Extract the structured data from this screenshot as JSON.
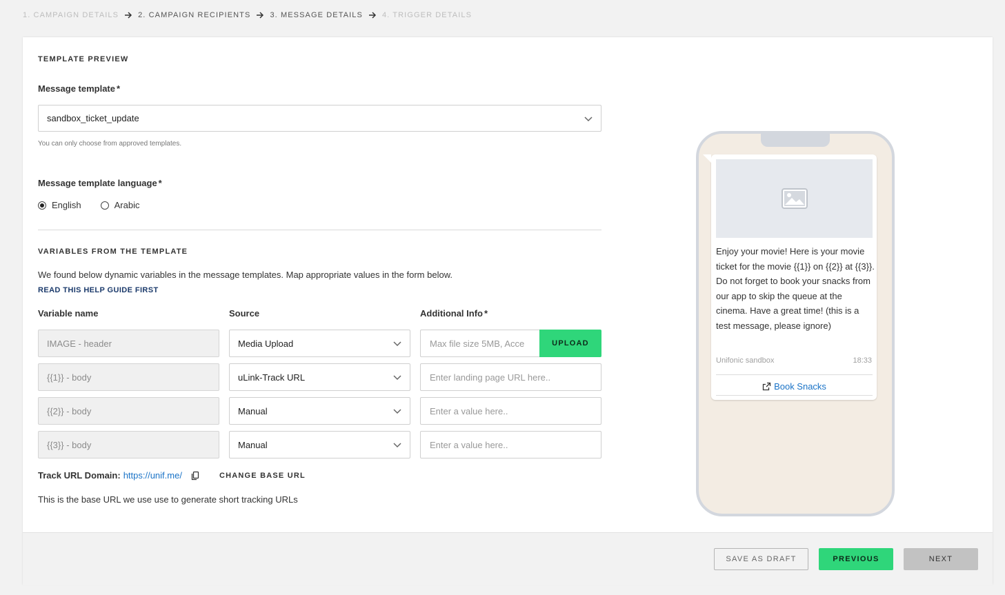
{
  "stepper": {
    "steps": [
      {
        "label": "1. CAMPAIGN DETAILS",
        "state": "inactive"
      },
      {
        "label": "2. CAMPAIGN RECIPIENTS",
        "state": "active"
      },
      {
        "label": "3. MESSAGE DETAILS",
        "state": "active"
      },
      {
        "label": "4. TRIGGER DETAILS",
        "state": "inactive"
      }
    ]
  },
  "template_preview": {
    "title": "TEMPLATE PREVIEW",
    "message_template": {
      "label": "Message template",
      "required_mark": "*",
      "value": "sandbox_ticket_update",
      "helper": "You can only choose from approved templates."
    },
    "language": {
      "label": "Message template language",
      "required_mark": "*",
      "options": [
        {
          "label": "English",
          "checked": true
        },
        {
          "label": "Arabic",
          "checked": false
        }
      ]
    }
  },
  "variables": {
    "title": "VARIABLES FROM THE TEMPLATE",
    "description": "We found below dynamic variables in the message templates. Map appropriate values in the form below.",
    "help_link": "READ THIS HELP GUIDE FIRST",
    "columns": {
      "name": "Variable name",
      "source": "Source",
      "info": "Additional Info",
      "info_required": "*"
    },
    "rows": [
      {
        "name": "IMAGE - header",
        "source": "Media Upload",
        "info_placeholder": "Max file size 5MB, Acce",
        "upload_label": "UPLOAD"
      },
      {
        "name": "{{1}} - body",
        "source": "uLink-Track URL",
        "info_placeholder": "Enter landing page URL here.."
      },
      {
        "name": "{{2}} - body",
        "source": "Manual",
        "info_placeholder": "Enter a value here.."
      },
      {
        "name": "{{3}} - body",
        "source": "Manual",
        "info_placeholder": "Enter a value here.."
      }
    ],
    "track": {
      "label": "Track URL Domain:",
      "url": "https://unif.me/",
      "change_label": "CHANGE BASE URL",
      "help": "This is the base URL we use use to generate short tracking URLs"
    }
  },
  "preview": {
    "message": "Enjoy your movie! Here is your movie ticket for the movie {{1}} on {{2}} at {{3}}. Do not forget to book your snacks from our app to skip the queue at the cinema. Have a great time! (this is a test message, please ignore)",
    "sender": "Unifonic sandbox",
    "time": "18:33",
    "cta": "Book Snacks"
  },
  "footer": {
    "save_draft": "SAVE AS DRAFT",
    "previous": "PREVIOUS",
    "next": "NEXT"
  },
  "colors": {
    "accent_green": "#2fd67a",
    "link_blue": "#1a73c7",
    "phone_bg": "#f3ece3"
  }
}
